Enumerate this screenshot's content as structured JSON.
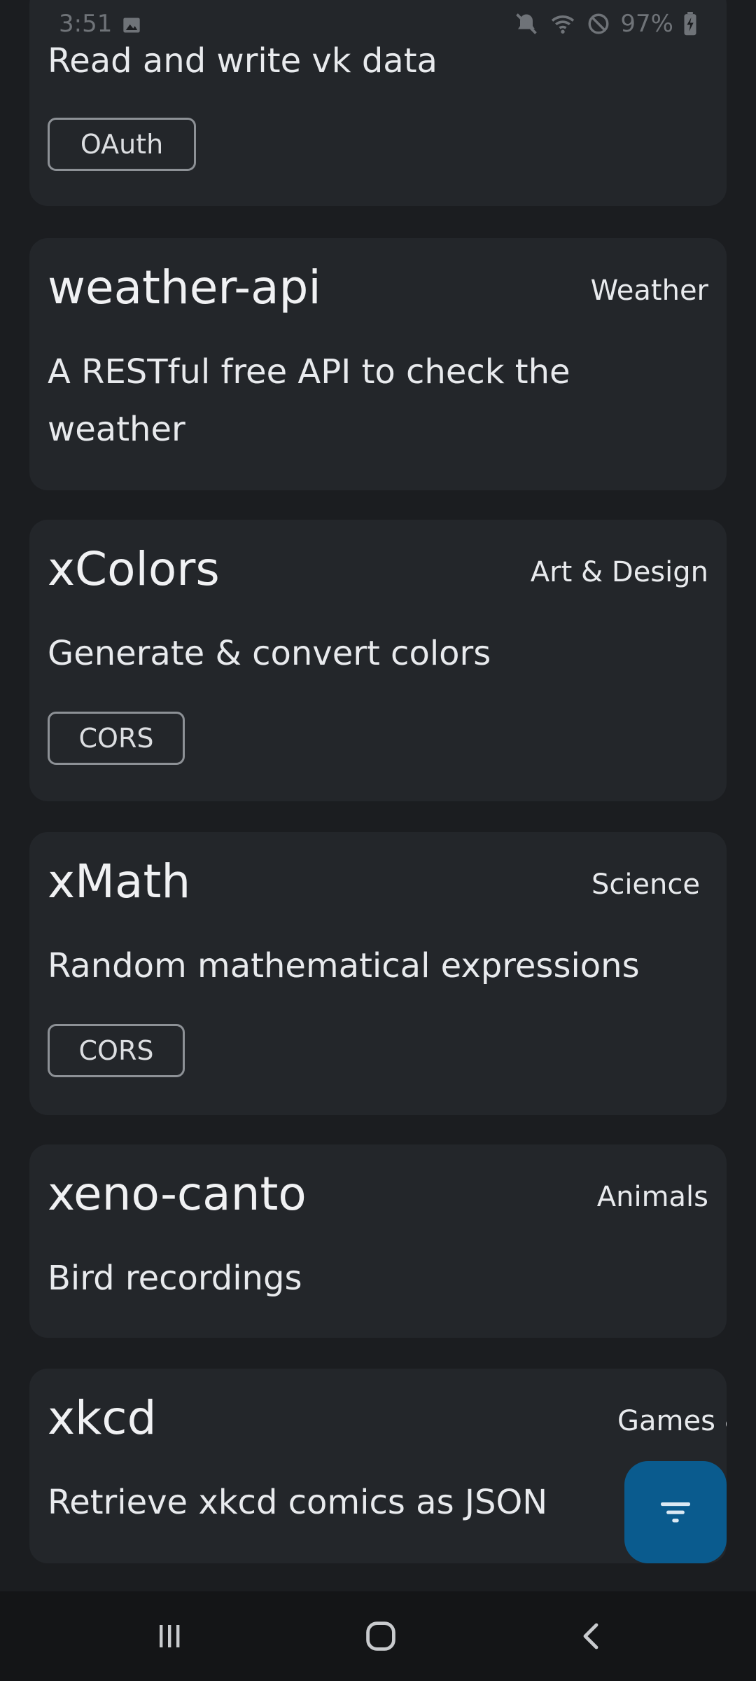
{
  "status_bar": {
    "time": "3:51",
    "battery": "97%",
    "icons": [
      "image-icon",
      "mute-icon",
      "wifi-icon",
      "dnd-icon",
      "battery-charging-icon"
    ]
  },
  "cards": [
    {
      "name": "",
      "category": "",
      "description": "Read and write vk data",
      "tag": "OAuth"
    },
    {
      "name": "weather-api",
      "category": "Weather",
      "description": "A RESTful free API to check the weather",
      "tag": ""
    },
    {
      "name": "xColors",
      "category": "Art & Design",
      "description": "Generate & convert colors",
      "tag": "CORS"
    },
    {
      "name": "xMath",
      "category": "Science",
      "description": "Random mathematical expressions",
      "tag": "CORS"
    },
    {
      "name": "xeno-canto",
      "category": "Animals",
      "description": "Bird recordings",
      "tag": ""
    },
    {
      "name": "xkcd",
      "category": "Games &",
      "description": "Retrieve xkcd comics as JSON",
      "tag": ""
    }
  ],
  "fab": {
    "icon": "filter-icon"
  },
  "nav_bar": {
    "icons": [
      "recent-apps-icon",
      "home-icon",
      "back-icon"
    ]
  },
  "colors": {
    "background": "#1b1d20",
    "card": "#23262a",
    "fab": "#0a5b8e",
    "nav_bar": "#141517"
  }
}
